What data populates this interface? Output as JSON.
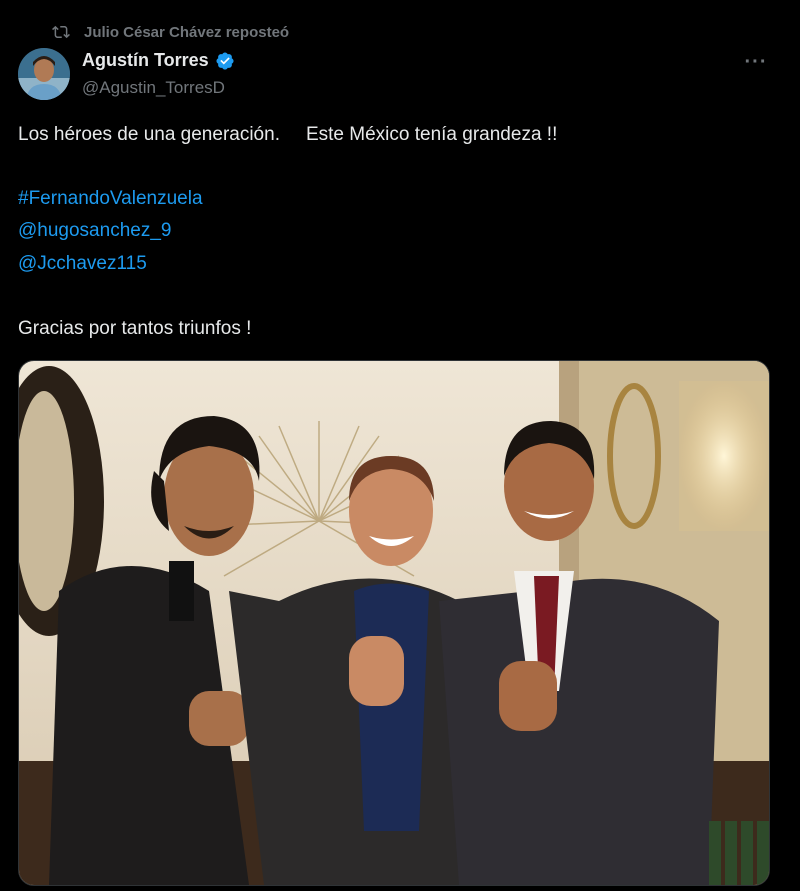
{
  "repost": {
    "label": "Julio César Chávez reposteó",
    "icon": "repost-icon"
  },
  "author": {
    "name": "Agustín Torres",
    "handle": "@Agustin_TorresD",
    "verified": true,
    "verified_color": "#1d9bf0"
  },
  "more_label": "···",
  "tweet": {
    "line1_part1": "Los héroes de una generación.",
    "line1_part2": "Este México tenía grandeza !!",
    "hashtag": "#FernandoValenzuela",
    "mention1": "@hugosanchez_9",
    "mention2": "@Jcchavez115",
    "closing": "Gracias por tantos triunfos !"
  },
  "colors": {
    "background": "#000000",
    "text": "#e7e9ea",
    "secondary": "#71767b",
    "link": "#1d9bf0"
  }
}
